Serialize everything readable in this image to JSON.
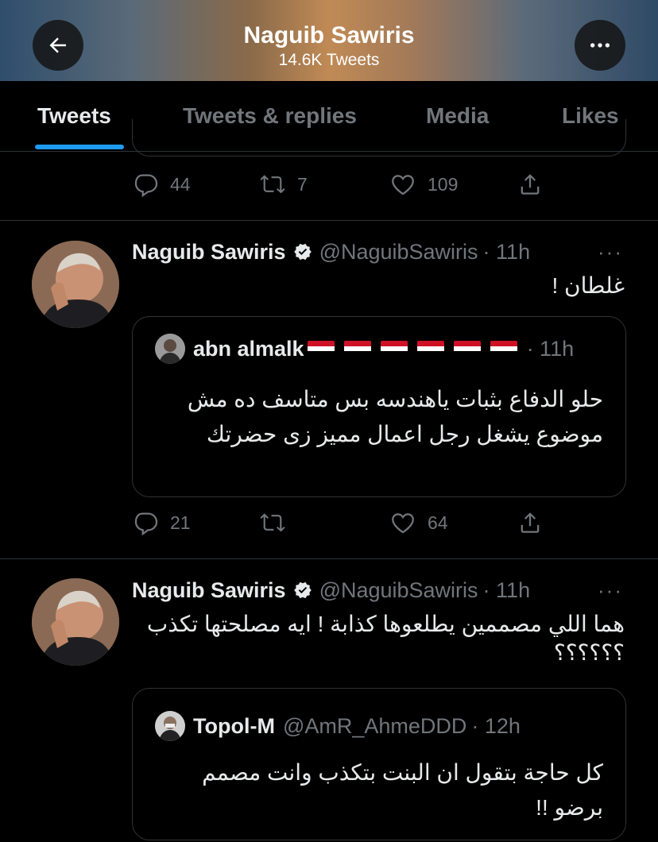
{
  "header": {
    "title": "Naguib Sawiris",
    "subtitle": "14.6K Tweets"
  },
  "tabs": [
    {
      "label": "Tweets",
      "active": true
    },
    {
      "label": "Tweets & replies",
      "active": false
    },
    {
      "label": "Media",
      "active": false
    },
    {
      "label": "Likes",
      "active": false
    }
  ],
  "prev_tweet": {
    "replies": "44",
    "retweets": "7",
    "likes": "109"
  },
  "tweets": [
    {
      "name": "Naguib Sawiris",
      "handle": "@NaguibSawiris",
      "time": "· 11h",
      "text": "غلطان !",
      "quote": {
        "name": "abn almalk",
        "handle": "",
        "time": "· 11h",
        "text": "حلو الدفاع بثبات ياهندسه بس متاسف ده مش موضوع يشغل رجل اعمال مميز زى حضرتك"
      },
      "replies": "21",
      "retweets": "",
      "likes": "64"
    },
    {
      "name": "Naguib Sawiris",
      "handle": "@NaguibSawiris",
      "time": "· 11h",
      "text": "هما اللي مصممين يطلعوها كذابة ! ايه مصلحتها تكذب ؟؟؟؟؟؟",
      "quote": {
        "name": "Topol-M",
        "handle": "@AmR_AhmeDDD",
        "time": "· 12h",
        "text": "كل حاجة بتقول ان البنت بتكذب وانت مصمم برضو !!"
      }
    }
  ],
  "colors": {
    "accent": "#1d9bf0",
    "muted": "#71767b",
    "text": "#e7e9ea",
    "border": "#2f3336"
  },
  "icons": [
    "back-arrow-icon",
    "more-icon",
    "reply-icon",
    "retweet-icon",
    "like-icon",
    "share-icon",
    "verified-icon",
    "egypt-flag-icon"
  ]
}
